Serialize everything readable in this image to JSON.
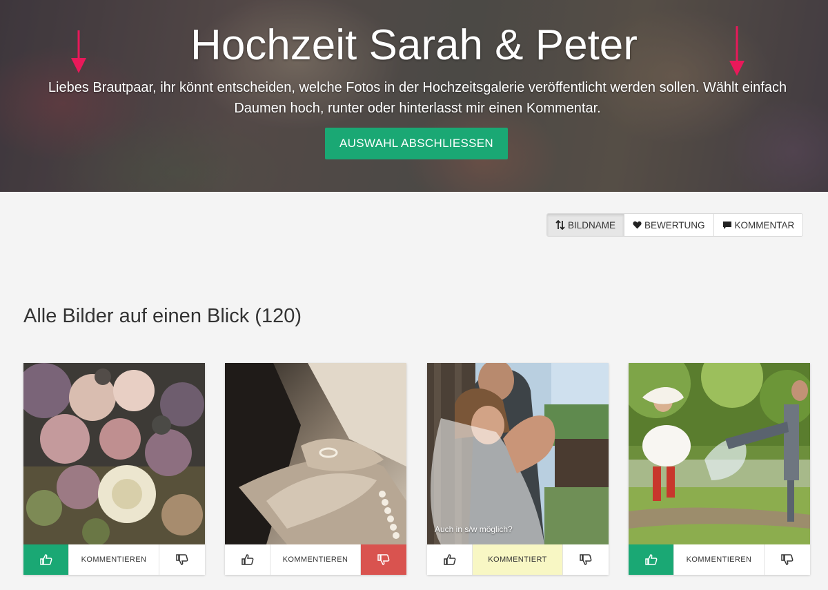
{
  "hero": {
    "title": "Hochzeit Sarah & Peter",
    "intro": "Liebes Brautpaar, ihr könnt entscheiden, welche Fotos in der Hochzeitsgalerie veröffentlicht werden sollen. Wählt einfach Daumen hoch, runter oder hinterlasst mir einen Kommentar.",
    "cta_label": "AUSWAHL ABSCHLIESSEN"
  },
  "sort": {
    "options": [
      {
        "label": "BILDNAME",
        "icon": "sort-arrows-icon",
        "active": true
      },
      {
        "label": "BEWERTUNG",
        "icon": "heart-icon",
        "active": false
      },
      {
        "label": "KOMMENTAR",
        "icon": "comment-icon",
        "active": false
      }
    ]
  },
  "gallery": {
    "heading": "Alle Bilder auf einen Blick (120)",
    "cards": [
      {
        "subject": "bouquet",
        "caption": "",
        "comment_label": "KOMMENTIEREN",
        "rating": "up"
      },
      {
        "subject": "rings",
        "caption": "",
        "comment_label": "KOMMENTIEREN",
        "rating": "down"
      },
      {
        "subject": "couple-veil",
        "caption": "Auch in s/w möglich?",
        "comment_label": "KOMMENTIERT",
        "rating": "none",
        "commented": true
      },
      {
        "subject": "couple-jump",
        "caption": "",
        "comment_label": "KOMMENTIEREN",
        "rating": "up"
      }
    ]
  },
  "colors": {
    "accent_green": "#1aa874",
    "reject_red": "#d9534f",
    "commented_yellow": "#f8f7c4",
    "annotation_arrow": "#e8195a"
  }
}
